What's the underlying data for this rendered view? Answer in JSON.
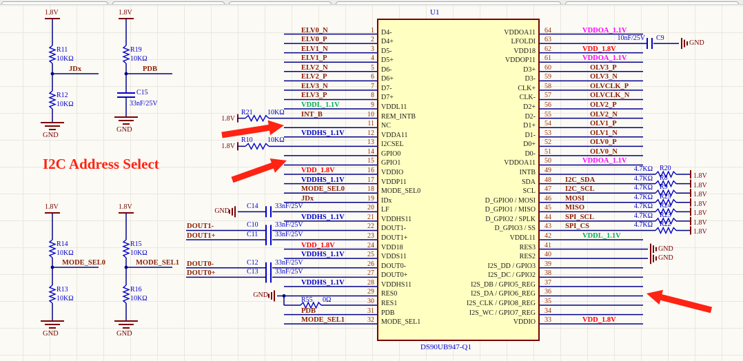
{
  "colors": {
    "wire": "#00008B",
    "comp": "#0000C8",
    "net_maroon": "#8B1E00",
    "net_red": "#FF0000",
    "net_green": "#00B050",
    "net_blue": "#0000CC",
    "net_magenta": "#FF00FF",
    "symbol": "#7A0000",
    "pin_number": "#9A3200",
    "pin_name": "#1A1A1A",
    "chip_fill": "#FFFFC2",
    "chip_border": "#7A0000",
    "annotation": "#FF2313",
    "part_text": "#0000CC"
  },
  "annotation": {
    "title": "I2C Address Select"
  },
  "chip": {
    "refdes": "U1",
    "part": "DS90UB947-Q1",
    "left_pins": [
      {
        "n": 1,
        "name": "D4-",
        "net": "ELV0_N",
        "c": "m",
        "t": "p"
      },
      {
        "n": 2,
        "name": "D4+",
        "net": "ELV0_P",
        "c": "m",
        "t": "p"
      },
      {
        "n": 3,
        "name": "D5-",
        "net": "ELV1_N",
        "c": "m",
        "t": "p"
      },
      {
        "n": 4,
        "name": "D5+",
        "net": "ELV1_P",
        "c": "m",
        "t": "p"
      },
      {
        "n": 5,
        "name": "D6-",
        "net": "ELV2_N",
        "c": "m",
        "t": "p"
      },
      {
        "n": 6,
        "name": "D6+",
        "net": "ELV2_P",
        "c": "m",
        "t": "p"
      },
      {
        "n": 7,
        "name": "D7-",
        "net": "ELV3_N",
        "c": "m",
        "t": "p"
      },
      {
        "n": 8,
        "name": "D7+",
        "net": "ELV3_P",
        "c": "m",
        "t": "p"
      },
      {
        "n": 9,
        "name": "VDDL11",
        "net": "VDDL_1.1V",
        "c": "g",
        "t": "p"
      },
      {
        "n": 10,
        "name": "REM_INTB",
        "net": "INT_B",
        "c": "m",
        "t": "rp",
        "ref": "R21",
        "val": "10KΩ",
        "rail": "1.8V"
      },
      {
        "n": 11,
        "name": "NC",
        "net": "",
        "t": "p"
      },
      {
        "n": 12,
        "name": "VDDA11",
        "net": "VDDHS_1.1V",
        "c": "b",
        "t": "p"
      },
      {
        "n": 13,
        "name": "I2CSEL",
        "net": "",
        "t": "rp",
        "ref": "R10",
        "val": "10KΩ",
        "rail": "1.8V"
      },
      {
        "n": 14,
        "name": "GPIO0",
        "net": "",
        "t": "p"
      },
      {
        "n": 15,
        "name": "GPIO1",
        "net": "",
        "t": "p"
      },
      {
        "n": 16,
        "name": "VDDIO",
        "net": "VDD_1.8V",
        "c": "r",
        "t": "p"
      },
      {
        "n": 17,
        "name": "VDDP11",
        "net": "VDDHS_1.1V",
        "c": "b",
        "t": "p"
      },
      {
        "n": 18,
        "name": "MODE_SEL0",
        "net": "MODE_SEL0",
        "c": "m",
        "t": "p"
      },
      {
        "n": 19,
        "name": "IDx",
        "net": "JDx",
        "c": "m",
        "t": "p"
      },
      {
        "n": 20,
        "name": "LF",
        "net": "",
        "t": "cg",
        "ref": "C14",
        "val": "33nF/25V",
        "gnd": "GND"
      },
      {
        "n": 21,
        "name": "VDDHS11",
        "net": "VDDHS_1.1V",
        "c": "b",
        "t": "p"
      },
      {
        "n": 22,
        "name": "DOUT1-",
        "net": "DOUT1-",
        "c": "m",
        "t": "cs",
        "ref": "C10",
        "val": "33nF/25V"
      },
      {
        "n": 23,
        "name": "DOUT1+",
        "net": "DOUT1+",
        "c": "m",
        "t": "cs",
        "ref": "C11",
        "val": "33nF/25V"
      },
      {
        "n": 24,
        "name": "VDD18",
        "net": "VDD_1.8V",
        "c": "r",
        "t": "p"
      },
      {
        "n": 25,
        "name": "VDDS11",
        "net": "VDDHS_1.1V",
        "c": "b",
        "t": "p"
      },
      {
        "n": 26,
        "name": "DOUT0-",
        "net": "DOUT0-",
        "c": "m",
        "t": "cs",
        "ref": "C12",
        "val": "33nF/25V"
      },
      {
        "n": 27,
        "name": "DOUT0+",
        "net": "DOUT0+",
        "c": "m",
        "t": "cs",
        "ref": "C13",
        "val": "33nF/25V"
      },
      {
        "n": 28,
        "name": "VDDHS11",
        "net": "VDDHS_1.1V",
        "c": "b",
        "t": "p"
      },
      {
        "n": 29,
        "name": "RES0",
        "net": "",
        "t": "gj",
        "gnd": "GND"
      },
      {
        "n": 30,
        "name": "RES1",
        "net": "",
        "t": "rs",
        "ref": "R55",
        "val": "0Ω"
      },
      {
        "n": 31,
        "name": "PDB",
        "net": "PDB",
        "c": "m",
        "t": "p"
      },
      {
        "n": 32,
        "name": "MODE_SEL1",
        "net": "MODE_SEL1",
        "c": "m",
        "t": "p"
      }
    ],
    "right_pins": [
      {
        "n": 64,
        "name": "VDDOA11",
        "net": "VDDOA_1.1V",
        "c": "p",
        "t": "p"
      },
      {
        "n": 63,
        "name": "LFOLDI",
        "net": "",
        "t": "cg9",
        "ref": "C9",
        "val": "10nF/25V",
        "gnd": "GND"
      },
      {
        "n": 62,
        "name": "VDD18",
        "net": "VDD_1.8V",
        "c": "r",
        "t": "p"
      },
      {
        "n": 61,
        "name": "VDDOP11",
        "net": "VDDOA_1.1V",
        "c": "p",
        "t": "p"
      },
      {
        "n": 60,
        "name": "D3+",
        "net": "OLV3_P",
        "c": "m",
        "t": "p"
      },
      {
        "n": 59,
        "name": "D3-",
        "net": "OLV3_N",
        "c": "m",
        "t": "p"
      },
      {
        "n": 58,
        "name": "CLK+",
        "net": "OLVCLK_P",
        "c": "m",
        "t": "p"
      },
      {
        "n": 57,
        "name": "CLK-",
        "net": "OLVCLK_N",
        "c": "m",
        "t": "p"
      },
      {
        "n": 56,
        "name": "D2+",
        "net": "OLV2_P",
        "c": "m",
        "t": "p"
      },
      {
        "n": 55,
        "name": "D2-",
        "net": "OLV2_N",
        "c": "m",
        "t": "p"
      },
      {
        "n": 54,
        "name": "D1+",
        "net": "OLV1_P",
        "c": "m",
        "t": "p"
      },
      {
        "n": 53,
        "name": "D1-",
        "net": "OLV1_N",
        "c": "m",
        "t": "p"
      },
      {
        "n": 52,
        "name": "D0+",
        "net": "OLV0_P",
        "c": "m",
        "t": "p"
      },
      {
        "n": 51,
        "name": "D0-",
        "net": "OLV0_N",
        "c": "m",
        "t": "p"
      },
      {
        "n": 50,
        "name": "VDDOA11",
        "net": "VDDOA_1.1V",
        "c": "p",
        "t": "p"
      },
      {
        "n": 49,
        "name": "INTB",
        "net": "",
        "t": "pu",
        "ref": "R20",
        "val": "4.7KΩ",
        "rail": "1.8V"
      },
      {
        "n": 48,
        "name": "SDA",
        "net": "I2C_SDA",
        "c": "m",
        "t": "pu",
        "ref": "R8",
        "val": "4.7KΩ",
        "rail": "1.8V"
      },
      {
        "n": 47,
        "name": "SCL",
        "net": "I2C_SCL",
        "c": "m",
        "t": "pu",
        "ref": "R9",
        "val": "4.7KΩ",
        "rail": "1.8V"
      },
      {
        "n": 46,
        "name": "D_GPIO0 / MOSI",
        "net": "MOSI",
        "c": "m",
        "t": "pu",
        "ref": "R25",
        "val": "4.7KΩ",
        "rail": "1.8V"
      },
      {
        "n": 45,
        "name": "D_GPIO1 / MISO",
        "net": "MISO",
        "c": "m",
        "t": "pu",
        "ref": "R24",
        "val": "4.7KΩ",
        "rail": "1.8V"
      },
      {
        "n": 44,
        "name": "D_GPIO2 / SPLK",
        "net": "SPI_SCL",
        "c": "m",
        "t": "pu",
        "ref": "R23",
        "val": "4.7KΩ",
        "rail": "1.8V"
      },
      {
        "n": 43,
        "name": "D_GPIO3 / SS",
        "net": "SPI_CS",
        "c": "m",
        "t": "pu",
        "ref": "R22",
        "val": "4.7KΩ",
        "rail": "1.8V"
      },
      {
        "n": 42,
        "name": "VDDL11",
        "net": "VDDL_1.1V",
        "c": "g",
        "t": "p"
      },
      {
        "n": 41,
        "name": "RES3",
        "net": "",
        "t": "g",
        "gnd": "GND"
      },
      {
        "n": 40,
        "name": "RES2",
        "net": "",
        "t": "g",
        "gnd": "GND"
      },
      {
        "n": 39,
        "name": "I2S_DD / GPIO3",
        "net": "",
        "t": "p"
      },
      {
        "n": 38,
        "name": "I2S_DC / GPIO2",
        "net": "",
        "t": "p"
      },
      {
        "n": 37,
        "name": "I2S_DB / GPIO5_REG",
        "net": "",
        "t": "p"
      },
      {
        "n": 36,
        "name": "I2S_DA / GPIO6_REG",
        "net": "",
        "t": "p"
      },
      {
        "n": 35,
        "name": "I2S_CLK / GPIO8_REG",
        "net": "",
        "t": "p"
      },
      {
        "n": 34,
        "name": "I2S_WC / GPIO7_REG",
        "net": "",
        "t": "p"
      },
      {
        "n": 33,
        "name": "VDDIO",
        "net": "VDD_1.8V",
        "c": "r",
        "t": "p"
      }
    ]
  },
  "networks": [
    {
      "rail": "1.8V",
      "top": {
        "ref": "R11",
        "val": "10KΩ"
      },
      "net": "JDx",
      "bottom": {
        "kind": "res",
        "ref": "R12",
        "val": "10KΩ"
      },
      "gnd": "GND"
    },
    {
      "rail": "1.8V",
      "top": {
        "ref": "R19",
        "val": "10KΩ"
      },
      "net": "PDB",
      "bottom": {
        "kind": "cap",
        "ref": "C15",
        "val": "33nF/25V"
      },
      "gnd": "GND"
    },
    {
      "rail": "1.8V",
      "top": {
        "ref": "R14",
        "val": "10KΩ"
      },
      "net": "MODE_SEL0",
      "bottom": {
        "kind": "res",
        "ref": "R13",
        "val": "10KΩ"
      },
      "gnd": "GND"
    },
    {
      "rail": "1.8V",
      "top": {
        "ref": "R15",
        "val": "10KΩ"
      },
      "net": "MODE_SEL1",
      "bottom": {
        "kind": "res",
        "ref": "R16",
        "val": "10KΩ"
      },
      "gnd": "GND"
    }
  ]
}
